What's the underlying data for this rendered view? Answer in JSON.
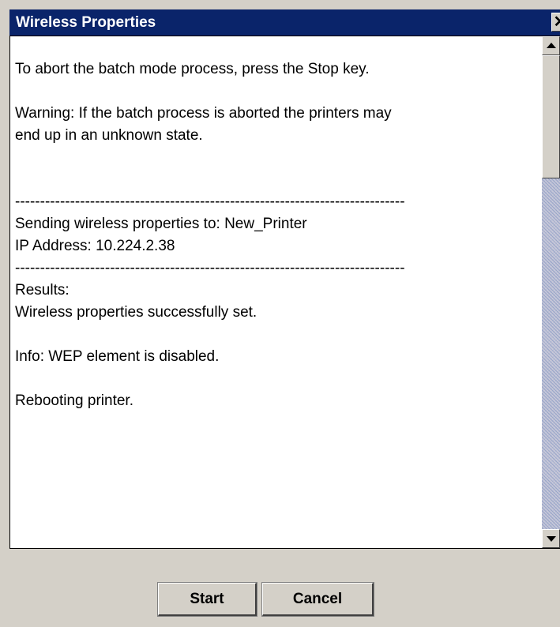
{
  "window": {
    "title": "Wireless Properties",
    "close_label": "✕"
  },
  "log": {
    "lines": [
      "",
      "To abort the batch mode process, press the Stop key.",
      "",
      "Warning: If the batch process is aborted the printers may",
      "end up in an unknown state.",
      "",
      "",
      "------------------------------------------------------------------------------",
      "Sending wireless properties to: New_Printer",
      "IP Address: 10.224.2.38",
      "------------------------------------------------------------------------------",
      "Results:",
      "Wireless properties successfully set.",
      "",
      "Info: WEP element is disabled.",
      "",
      "Rebooting printer."
    ]
  },
  "scrollbar": {
    "up_icon": "arrow-up",
    "down_icon": "arrow-down",
    "position": 0.0
  },
  "buttons": {
    "start_label": "Start",
    "cancel_label": "Cancel"
  },
  "colors": {
    "titlebar": "#0a246a",
    "title_text": "#ffffff",
    "panel": "#d4d0c8",
    "content_bg": "#ffffff"
  }
}
